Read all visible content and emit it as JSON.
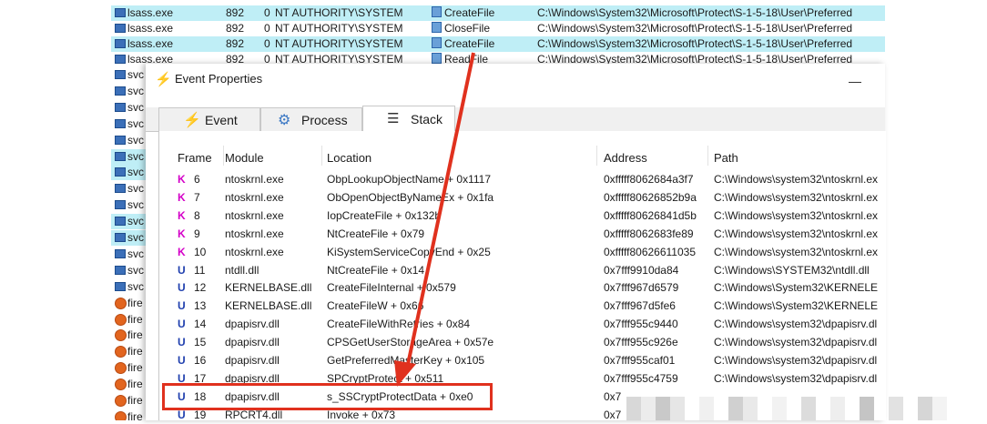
{
  "background_rows": [
    {
      "process": "lsass.exe",
      "pid": "892",
      "session": "0",
      "user": "NT AUTHORITY\\SYSTEM",
      "operation": "CreateFile",
      "path": "C:\\Windows\\System32\\Microsoft\\Protect\\S-1-5-18\\User\\Preferred",
      "highlight": true
    },
    {
      "process": "lsass.exe",
      "pid": "892",
      "session": "0",
      "user": "NT AUTHORITY\\SYSTEM",
      "operation": "CloseFile",
      "path": "C:\\Windows\\System32\\Microsoft\\Protect\\S-1-5-18\\User\\Preferred",
      "highlight": false
    },
    {
      "process": "lsass.exe",
      "pid": "892",
      "session": "0",
      "user": "NT AUTHORITY\\SYSTEM",
      "operation": "CreateFile",
      "path": "C:\\Windows\\System32\\Microsoft\\Protect\\S-1-5-18\\User\\Preferred",
      "highlight": true
    },
    {
      "process": "lsass.exe",
      "pid": "892",
      "session": "0",
      "user": "NT AUTHORITY\\SYSTEM",
      "operation": "ReadFile",
      "path": "C:\\Windows\\System32\\Microsoft\\Protect\\S-1-5-18\\User\\Preferred",
      "highlight": false
    }
  ],
  "side_rows": [
    {
      "label": "svc",
      "fox": false,
      "highlight": false
    },
    {
      "label": "svc",
      "fox": false,
      "highlight": false
    },
    {
      "label": "svc",
      "fox": false,
      "highlight": false
    },
    {
      "label": "svc",
      "fox": false,
      "highlight": false
    },
    {
      "label": "svc",
      "fox": false,
      "highlight": false
    },
    {
      "label": "svc",
      "fox": false,
      "highlight": true
    },
    {
      "label": "svc",
      "fox": false,
      "highlight": true
    },
    {
      "label": "svc",
      "fox": false,
      "highlight": false
    },
    {
      "label": "svc",
      "fox": false,
      "highlight": false
    },
    {
      "label": "svc",
      "fox": false,
      "highlight": true
    },
    {
      "label": "svc",
      "fox": false,
      "highlight": true
    },
    {
      "label": "svc",
      "fox": false,
      "highlight": false
    },
    {
      "label": "svc",
      "fox": false,
      "highlight": false
    },
    {
      "label": "svc",
      "fox": false,
      "highlight": false
    },
    {
      "label": "fire",
      "fox": true,
      "highlight": false
    },
    {
      "label": "fire",
      "fox": true,
      "highlight": false
    },
    {
      "label": "fire",
      "fox": true,
      "highlight": false
    },
    {
      "label": "fire",
      "fox": true,
      "highlight": false
    },
    {
      "label": "fire",
      "fox": true,
      "highlight": false
    },
    {
      "label": "fire",
      "fox": true,
      "highlight": false
    },
    {
      "label": "fire",
      "fox": true,
      "highlight": false
    },
    {
      "label": "fire",
      "fox": true,
      "highlight": false
    }
  ],
  "dialog": {
    "title": "Event Properties",
    "tabs": [
      {
        "label": "Event",
        "icon": "lightning-icon"
      },
      {
        "label": "Process",
        "icon": "gear-icon"
      },
      {
        "label": "Stack",
        "icon": "stack-icon"
      }
    ],
    "active_tab": "Stack"
  },
  "stack": {
    "columns": [
      "Frame",
      "Module",
      "Location",
      "Address",
      "Path"
    ],
    "rows": [
      {
        "mode": "K",
        "frame": "6",
        "module": "ntoskrnl.exe",
        "location": "ObpLookupObjectName + 0x1117",
        "address": "0xfffff8062684a3f7",
        "path": "C:\\Windows\\system32\\ntoskrnl.ex"
      },
      {
        "mode": "K",
        "frame": "7",
        "module": "ntoskrnl.exe",
        "location": "ObOpenObjectByNameEx + 0x1fa",
        "address": "0xfffff80626852b9a",
        "path": "C:\\Windows\\system32\\ntoskrnl.ex"
      },
      {
        "mode": "K",
        "frame": "8",
        "module": "ntoskrnl.exe",
        "location": "IopCreateFile + 0x132b",
        "address": "0xfffff80626841d5b",
        "path": "C:\\Windows\\system32\\ntoskrnl.ex"
      },
      {
        "mode": "K",
        "frame": "9",
        "module": "ntoskrnl.exe",
        "location": "NtCreateFile + 0x79",
        "address": "0xfffff8062683fe89",
        "path": "C:\\Windows\\system32\\ntoskrnl.ex"
      },
      {
        "mode": "K",
        "frame": "10",
        "module": "ntoskrnl.exe",
        "location": "KiSystemServiceCopyEnd + 0x25",
        "address": "0xfffff80626611035",
        "path": "C:\\Windows\\system32\\ntoskrnl.ex"
      },
      {
        "mode": "U",
        "frame": "11",
        "module": "ntdll.dll",
        "location": "NtCreateFile + 0x14",
        "address": "0x7fff9910da84",
        "path": "C:\\Windows\\SYSTEM32\\ntdll.dll"
      },
      {
        "mode": "U",
        "frame": "12",
        "module": "KERNELBASE.dll",
        "location": "CreateFileInternal + 0x579",
        "address": "0x7fff967d6579",
        "path": "C:\\Windows\\System32\\KERNELE"
      },
      {
        "mode": "U",
        "frame": "13",
        "module": "KERNELBASE.dll",
        "location": "CreateFileW + 0x66",
        "address": "0x7fff967d5fe6",
        "path": "C:\\Windows\\System32\\KERNELE"
      },
      {
        "mode": "U",
        "frame": "14",
        "module": "dpapisrv.dll",
        "location": "CreateFileWithRetries + 0x84",
        "address": "0x7fff955c9440",
        "path": "C:\\Windows\\system32\\dpapisrv.dl"
      },
      {
        "mode": "U",
        "frame": "15",
        "module": "dpapisrv.dll",
        "location": "CPSGetUserStorageArea + 0x57e",
        "address": "0x7fff955c926e",
        "path": "C:\\Windows\\system32\\dpapisrv.dl"
      },
      {
        "mode": "U",
        "frame": "16",
        "module": "dpapisrv.dll",
        "location": "GetPreferredMasterKey + 0x105",
        "address": "0x7fff955caf01",
        "path": "C:\\Windows\\system32\\dpapisrv.dl"
      },
      {
        "mode": "U",
        "frame": "17",
        "module": "dpapisrv.dll",
        "location": "SPCryptProtect + 0x511",
        "address": "0x7fff955c4759",
        "path": "C:\\Windows\\system32\\dpapisrv.dl"
      },
      {
        "mode": "U",
        "frame": "18",
        "module": "dpapisrv.dll",
        "location": "s_SSCryptProtectData + 0xe0",
        "address": "0x7",
        "path": ""
      },
      {
        "mode": "U",
        "frame": "19",
        "module": "RPCRT4.dll",
        "location": "Invoke + 0x73",
        "address": "0x7",
        "path": ""
      }
    ]
  },
  "colors": {
    "kernel": "#d400c8",
    "user": "#1f3fae",
    "highlight": "#bfeef6",
    "annotation": "#e0311e"
  }
}
